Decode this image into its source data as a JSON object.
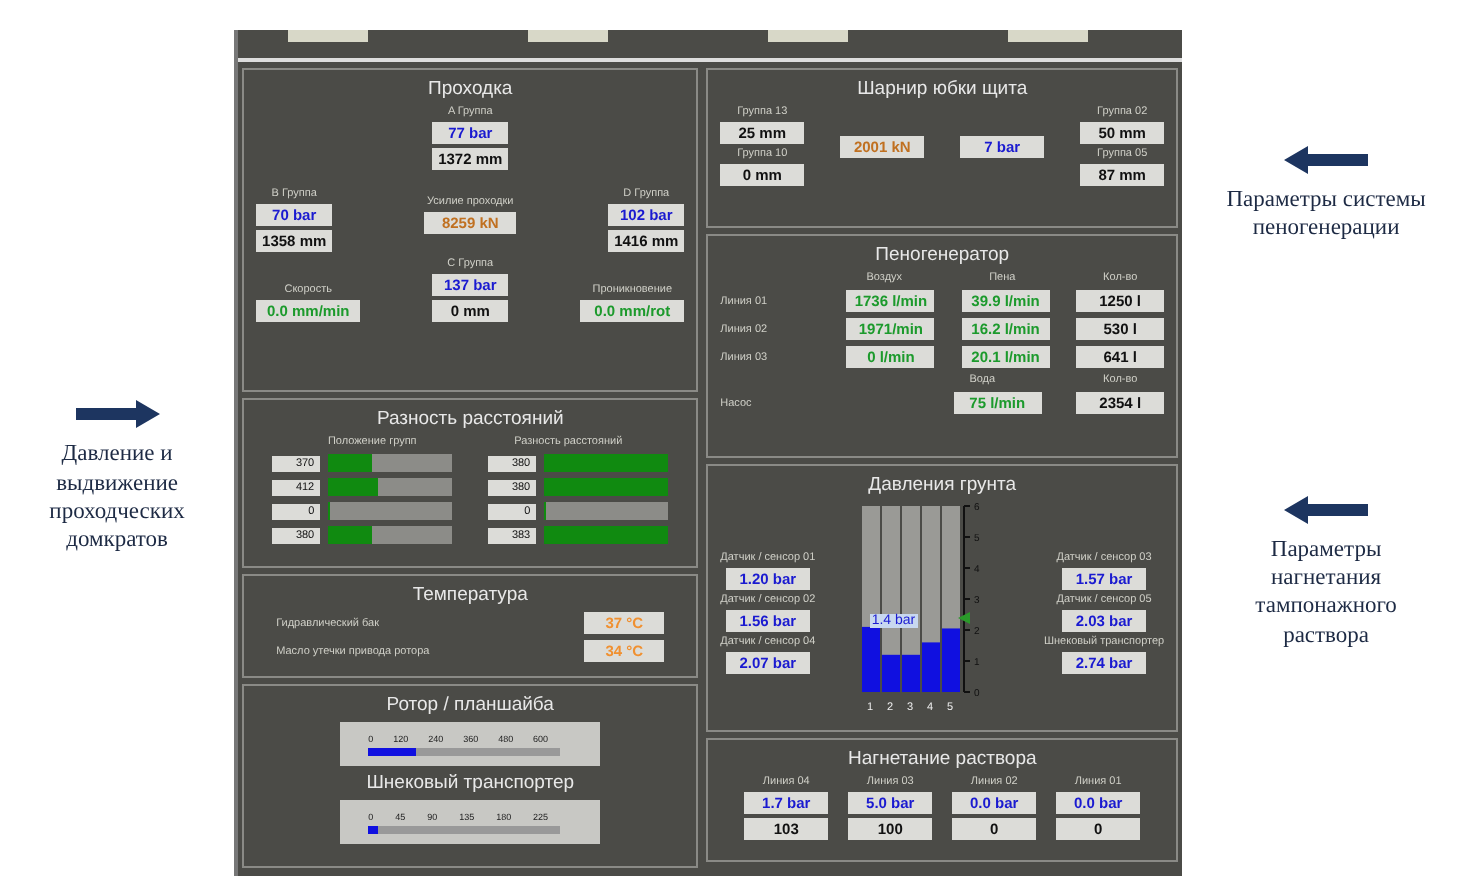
{
  "left_note": {
    "text": "Давление и выдвижение проходческих домкратов"
  },
  "right_notes": [
    {
      "text": "Параметры системы пеногенерации"
    },
    {
      "text": "Параметры нагнетания тампонажного раствора"
    }
  ],
  "tunneling": {
    "title": "Проходка",
    "group_a": {
      "label": "A Группа",
      "pressure": "77 bar",
      "stroke": "1372 mm"
    },
    "group_b": {
      "label": "B Группа",
      "pressure": "70 bar",
      "stroke": "1358 mm"
    },
    "group_d": {
      "label": "D Группа",
      "pressure": "102 bar",
      "stroke": "1416 mm"
    },
    "group_c": {
      "label": "C Группа",
      "pressure": "137 bar",
      "stroke": "0 mm"
    },
    "thrust": {
      "label": "Усилие проходки",
      "value": "8259 kN"
    },
    "speed": {
      "label": "Скорость",
      "value": "0.0 mm/min"
    },
    "penetration": {
      "label": "Проникновение",
      "value": "0.0 mm/rot"
    }
  },
  "distance": {
    "title": "Разность расстояний",
    "left_header": "Положение групп",
    "right_header": "Разность расстояний",
    "positions": [
      {
        "value": "370",
        "level": 0.35
      },
      {
        "value": "412",
        "level": 0.4
      },
      {
        "value": "0",
        "level": 0
      },
      {
        "value": "380",
        "level": 0.35
      }
    ],
    "differences": [
      {
        "value": "380",
        "level": 1
      },
      {
        "value": "380",
        "level": 1
      },
      {
        "value": "0",
        "level": 0
      },
      {
        "value": "383",
        "level": 1
      }
    ]
  },
  "temperature": {
    "title": "Температура",
    "rows": [
      {
        "label": "Гидравлический бак",
        "value": "37 °C"
      },
      {
        "label": "Масло утечки привода ротора",
        "value": "34 °C"
      }
    ]
  },
  "rotor": {
    "title": "Ротор / планшайба",
    "ticks": [
      "0",
      "120",
      "240",
      "360",
      "480",
      "600"
    ],
    "level": 0.25
  },
  "auger": {
    "title": "Шнековый транспортер",
    "ticks": [
      "0",
      "45",
      "90",
      "135",
      "180",
      "225"
    ],
    "level": 0.05
  },
  "skirt": {
    "title": "Шарнир юбки щита",
    "left": [
      {
        "label": "Группа 13",
        "value": "25 mm"
      },
      {
        "label": "Группа 10",
        "value": "0 mm"
      }
    ],
    "right": [
      {
        "label": "Группа 02",
        "value": "50 mm"
      },
      {
        "label": "Группа 05",
        "value": "87 mm"
      }
    ],
    "force": "2001 kN",
    "pressure": "7 bar"
  },
  "foam": {
    "title": "Пеногенератор",
    "headers": [
      "Воздух",
      "Пена",
      "Кол-во"
    ],
    "rows": [
      {
        "label": "Линия 01",
        "values": [
          "1736 l/min",
          "39.9 l/min",
          "1250 l"
        ]
      },
      {
        "label": "Линия 02",
        "values": [
          "1971/min",
          "16.2 l/min",
          "530 l"
        ]
      },
      {
        "label": "Линия 03",
        "values": [
          "0 l/min",
          "20.1 l/min",
          "641 l"
        ]
      }
    ],
    "pump_headers": [
      "Вода",
      "Кол-во"
    ],
    "pump": {
      "label": "Насос",
      "values": [
        "75 l/min",
        "2354 l"
      ]
    }
  },
  "soil": {
    "title": "Давления грунта",
    "left": [
      {
        "label": "Датчик / сенсор 01",
        "value": "1.20 bar"
      },
      {
        "label": "Датчик / сенсор 02",
        "value": "1.56 bar"
      },
      {
        "label": "Датчик / сенсор 04",
        "value": "2.07 bar"
      }
    ],
    "right": [
      {
        "label": "Датчик / сенсор 03",
        "value": "1.57 bar"
      },
      {
        "label": "Датчик / сенсор 05",
        "value": "2.03 bar"
      },
      {
        "label": "Шнековый транспортер",
        "value": "2.74 bar"
      }
    ],
    "bar_label": "1.4 bar",
    "chart_data": {
      "type": "bar",
      "categories": [
        "1",
        "2",
        "3",
        "4",
        "5"
      ],
      "series": [
        {
          "color": "#1010e0",
          "values": [
            2.1,
            1.2,
            1.2,
            1.6,
            2.05
          ]
        }
      ],
      "ylim": [
        0,
        6
      ],
      "yticks": [
        0,
        1,
        2,
        3,
        4,
        5,
        6
      ]
    }
  },
  "grout": {
    "title": "Нагнетание раствора",
    "lines": [
      {
        "label": "Линия 04",
        "pressure": "1.7 bar",
        "count": "103"
      },
      {
        "label": "Линия 03",
        "pressure": "5.0 bar",
        "count": "100"
      },
      {
        "label": "Линия 02",
        "pressure": "0.0 bar",
        "count": "0"
      },
      {
        "label": "Линия 01",
        "pressure": "0.0 bar",
        "count": "0"
      }
    ]
  }
}
